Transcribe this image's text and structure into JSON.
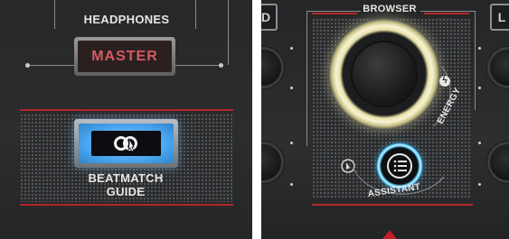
{
  "left": {
    "headphones_label": "HEADPHONES",
    "master_label": "MASTER",
    "beatmatch_label_line1": "BEATMATCH",
    "beatmatch_label_line2": "GUIDE"
  },
  "right": {
    "browser_label": "BROWSER",
    "energy_label": "ENERGY",
    "assistant_label": "ASSISTANT",
    "left_button_letter": "D",
    "right_button_letter": "L"
  },
  "colors": {
    "accent_red": "#b3262c",
    "master_text": "#d65a63",
    "beatmatch_glow": "#7cc4ff",
    "browser_ring": "#f3ecc0",
    "assistant_ring": "#5cc8ff"
  }
}
